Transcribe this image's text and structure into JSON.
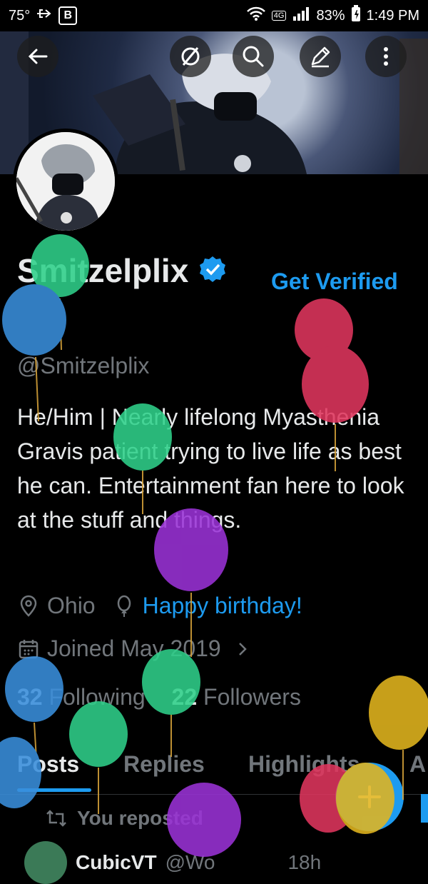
{
  "status_bar": {
    "temperature": "75°",
    "badge": "B",
    "network": "4G",
    "battery": "83%",
    "time": "1:49 PM"
  },
  "header_icons": [
    "back-arrow-icon",
    "circle-slash-icon",
    "search-icon",
    "edit-pencil-icon",
    "more-vertical-icon"
  ],
  "profile": {
    "display_name": "Smitzelplix",
    "get_verified": "Get Verified",
    "handle": "@Smitzelplix",
    "bio": "He/Him | Nearly lifelong Myasthenia Gravis patient trying to live life as best he can. Entertainment fan here to look at the stuff and things.",
    "location": "Ohio",
    "birthday": "Happy birthday!",
    "joined": "Joined May 2019",
    "following_count": "32",
    "following_label": "Following",
    "followers_count": "22",
    "followers_label": "Followers"
  },
  "tabs": [
    {
      "label": "Posts",
      "active": true
    },
    {
      "label": "Replies",
      "active": false
    },
    {
      "label": "Highlights",
      "active": false
    },
    {
      "label": "A",
      "active": false
    }
  ],
  "feed": {
    "repost_label": "You reposted",
    "first_post_author": "CubicVT",
    "first_post_handle": "@Wo",
    "first_post_time": "18h"
  },
  "fab_icon": "plus-icon",
  "colors": {
    "accent": "#1d9bf0",
    "background": "#000000",
    "text_primary": "#e7e9ea",
    "text_secondary": "#71767b"
  }
}
